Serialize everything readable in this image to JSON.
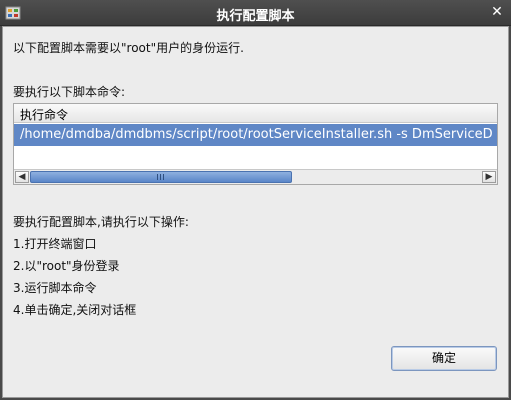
{
  "window": {
    "title": "执行配置脚本",
    "close_glyph": "✕",
    "icon": "app-icon"
  },
  "dialog": {
    "intro": "以下配置脚本需要以\"root\"用户的身份运行.",
    "commands_label": "要执行以下脚本命令:",
    "table": {
      "column_header": "执行命令",
      "rows": [
        "/home/dmdba/dmdbms/script/root/rootServiceInstaller.sh -s DmServiceD"
      ]
    },
    "scrollbar": {
      "position_fraction": 0.0,
      "visible_fraction": 0.58
    },
    "instructions_title": "要执行配置脚本,请执行以下操作:",
    "steps": [
      "1.打开终端窗口",
      "2.以\"root\"身份登录",
      "3.运行脚本命令",
      "4.单击确定,关闭对话框"
    ],
    "ok_label": "确定"
  },
  "colors": {
    "titlebar": "#3f3f3f",
    "selection": "#5f87c6",
    "dialog_bg": "#ececec"
  }
}
